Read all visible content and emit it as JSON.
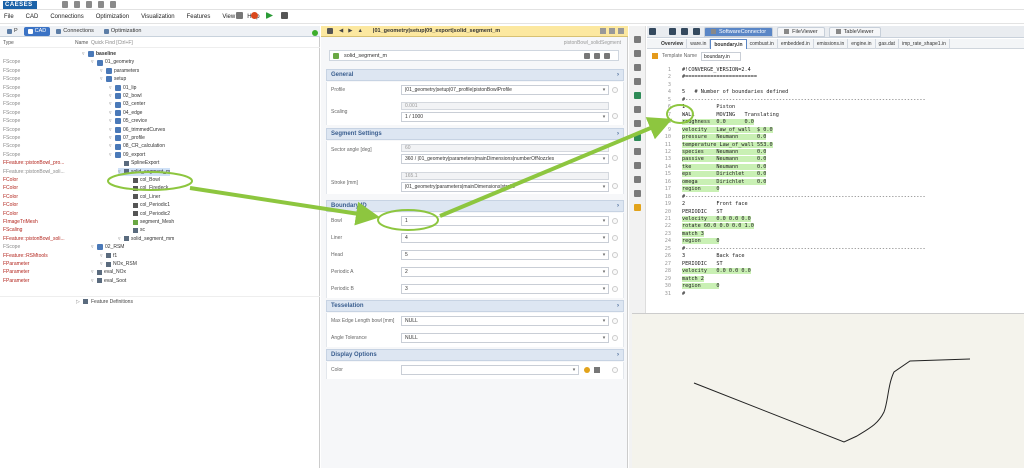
{
  "app": {
    "logo": "CAESES"
  },
  "menu": [
    "File",
    "CAD",
    "Connections",
    "Optimization",
    "Visualization",
    "Features",
    "View",
    "Help"
  ],
  "left_tabs": [
    {
      "label": "CAD"
    },
    {
      "label": "Connections"
    },
    {
      "label": "Optimization"
    }
  ],
  "left_header": {
    "type": "Type",
    "name": "Name",
    "filter": "Quick Find [Ctrl+F]"
  },
  "tree_rows": [
    {
      "type": "",
      "name": "baseline",
      "indent": 0,
      "bold": true
    },
    {
      "type": "FScope",
      "name": "01_geometry",
      "indent": 1
    },
    {
      "type": "FScope",
      "name": "parameters",
      "indent": 2
    },
    {
      "type": "FScope",
      "name": "setup",
      "indent": 2
    },
    {
      "type": "FScope",
      "name": "01_lip",
      "indent": 3
    },
    {
      "type": "FScope",
      "name": "02_bowl",
      "indent": 3
    },
    {
      "type": "FScope",
      "name": "03_center",
      "indent": 3
    },
    {
      "type": "FScope",
      "name": "04_edge",
      "indent": 3
    },
    {
      "type": "FScope",
      "name": "05_crevice",
      "indent": 3
    },
    {
      "type": "FScope",
      "name": "06_trimmedCurves",
      "indent": 3
    },
    {
      "type": "FScope",
      "name": "07_profile",
      "indent": 3
    },
    {
      "type": "FScope",
      "name": "08_CR_calculation",
      "indent": 3
    },
    {
      "type": "FScope",
      "name": "09_export",
      "indent": 3
    },
    {
      "type": "FFeature::pistonBowl_pro...",
      "name": "SplineExport",
      "indent": 4,
      "red": true
    },
    {
      "type": "FFeature::pistonBowl_soli...",
      "name": "solid_segment_m",
      "indent": 4,
      "sel": true
    },
    {
      "type": "FColor",
      "name": "col_Bowl",
      "indent": 5,
      "red": true
    },
    {
      "type": "FColor",
      "name": "col_Firedeck",
      "indent": 5,
      "red": true
    },
    {
      "type": "FColor",
      "name": "col_Liner",
      "indent": 5,
      "red": true
    },
    {
      "type": "FColor",
      "name": "col_Periodic1",
      "indent": 5,
      "red": true
    },
    {
      "type": "FColor",
      "name": "col_Periodic2",
      "indent": 5,
      "red": true
    },
    {
      "type": "FImageTriMesh",
      "name": "segment_Mesh",
      "indent": 5,
      "red": true
    },
    {
      "type": "FScaling",
      "name": "sc",
      "indent": 5,
      "red": true
    },
    {
      "type": "FFeature::pistonBowl_soli...",
      "name": "solid_segment_mm",
      "indent": 4,
      "red": true
    },
    {
      "type": "FScope",
      "name": "02_RSM",
      "indent": 1
    },
    {
      "type": "FFeature::RSMtools",
      "name": "f1",
      "indent": 2,
      "red": true
    },
    {
      "type": "FParameter",
      "name": "NOx_RSM",
      "indent": 2,
      "red": true
    },
    {
      "type": "FParameter",
      "name": "eval_NOx",
      "indent": 1,
      "red": true
    },
    {
      "type": "FParameter",
      "name": "eval_Soot",
      "indent": 1,
      "red": true
    }
  ],
  "feature_definitions": "Feature Definitions",
  "mid": {
    "path": "|01_geometry|setup|09_export|solid_segment_m",
    "subtitle": "pistonBowl_solidSegment",
    "name": "solid_segment_m",
    "general": "General",
    "profile_label": "Profile",
    "profile_value": "|01_geometry|setup|07_profile|pistonBowlProfile",
    "scaling_label": "Scaling",
    "scaling_grey": "0.001",
    "scaling_value": "1 / 1000",
    "segment_settings": "Segment Settings",
    "sector_label": "Sector angle [deg]",
    "sector_grey": "60",
    "sector_value": "360 / |01_geometry|parameters|mainDimensions|numberOfNozzles",
    "stroke_label": "Stroke [mm]",
    "stroke_grey": "165.1",
    "stroke_value": "|01_geometry|parameters|mainDimensions|stroke",
    "boundary_id": "Boundary ID",
    "bowl_label": "Bowl",
    "bowl_value": "1",
    "liner_label": "Liner",
    "liner_value": "4",
    "head_label": "Head",
    "head_value": "5",
    "pa_label": "Periodic A",
    "pa_value": "2",
    "pb_label": "Periodic B",
    "pb_value": "3",
    "tesselation": "Tesselation",
    "maxedge_label": "Max Edge Length bowl [mm]",
    "maxedge_value": "NULL",
    "angle_label": "Angle Tolerance",
    "angle_value": "NULL",
    "display_options": "Display Options",
    "color_label": "Color",
    "color_value": ""
  },
  "right": {
    "tabs": [
      {
        "label": "SoftwareConnector"
      },
      {
        "label": "FileViewer"
      },
      {
        "label": "TableViewer"
      }
    ],
    "file_tabs": [
      "Overview",
      "ware.in",
      "boundary.in",
      "combust.in",
      "embedded.in",
      "emissions.in",
      "engine.in",
      "gas.dat",
      "imp_rate_shape1.in"
    ],
    "template_label": "Template Name",
    "template_value": "boundary.in",
    "lines": [
      "#!CONVERGE_VERSION=2.4",
      "#=======================",
      "",
      "5   # Number of boundaries defined",
      "#-----------------------------------------------------------------------------",
      "1          Piston",
      "WALL       MOVING   Translating",
      "roughness  0.0      0.0",
      "velocity   Law_of_wall  $ 0.0",
      "pressure   Neumann      0.0",
      "temperature Law_of_wall 553.0",
      "species    Neumann      0.0",
      "passive    Neumann      0.0",
      "tke        Neumann      0.0",
      "eps        Dirichlet    0.0",
      "omega      Dirichlet    0.0",
      "region     0",
      "#-----------------------------------------------------------------------------",
      "2          Front face",
      "PERIODIC   ST",
      "velocity   0.0 0.0 0.0",
      "rotate 60.0 0.0 0.0 1.0",
      "match 3",
      "region     0",
      "#-----------------------------------------------------------------------------",
      "3          Back face",
      "PERIODIC   ST",
      "velocity   0.0 0.0 0.0",
      "match 2",
      "region     0",
      "#"
    ]
  },
  "colors": {
    "accent": "#3b73c5",
    "annotation": "#8dc63f",
    "header": "#fce8a0"
  }
}
